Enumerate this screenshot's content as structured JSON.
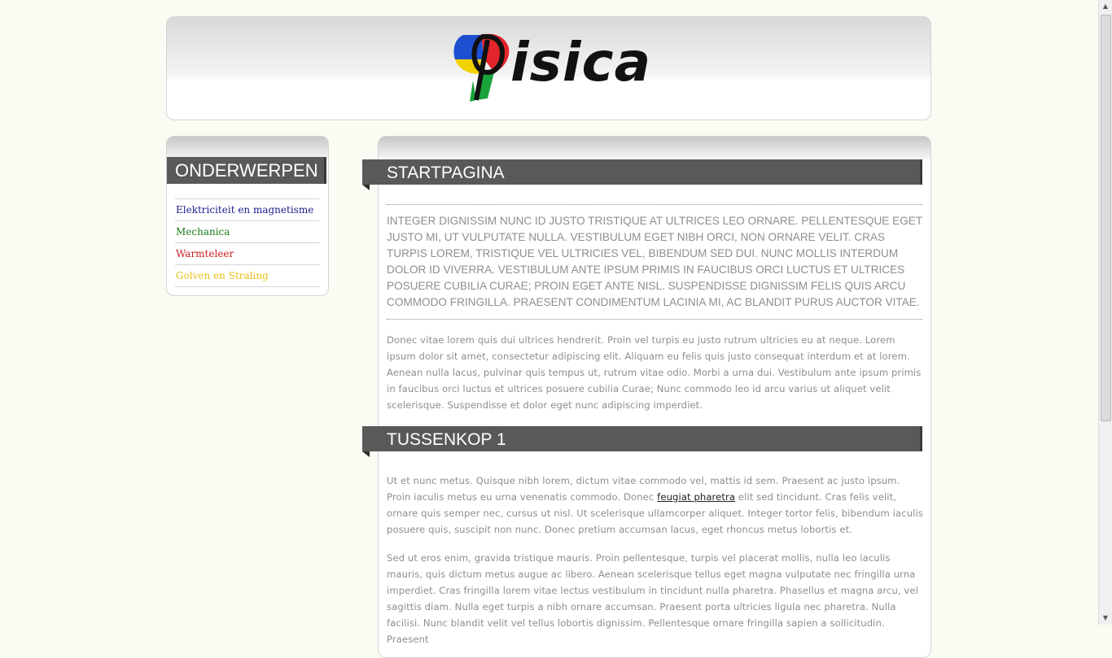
{
  "header": {
    "logo_text": "isica",
    "logo_colors": {
      "red": "#e3262b",
      "blue": "#1d4fd1",
      "yellow": "#f2d200",
      "green": "#19a33a"
    }
  },
  "sidebar": {
    "title": "ONDERWERPEN",
    "items": [
      {
        "label": "Elektriciteit en magnetisme",
        "color": "#1a1a8c"
      },
      {
        "label": "Mechanica",
        "color": "#1c7a1c"
      },
      {
        "label": "Warmteleer",
        "color": "#c8201e"
      },
      {
        "label": "Golven en Straling",
        "color": "#e8c21a"
      }
    ]
  },
  "main": {
    "title": "STARTPAGINA",
    "intro": "Integer dignissim nunc id justo tristique at ultrices leo ornare. Pellentesque eget justo mi, ut vulputate nulla. Vestibulum eget nibh orci, non ornare velit. Cras turpis lorem, tristique vel ultricies vel, bibendum sed dui. Nunc mollis interdum dolor id viverra. Vestibulum ante ipsum primis in faucibus orci luctus et ultrices posuere cubilia Curae; Proin eget ante nisl. Suspendisse dignissim felis quis arcu commodo fringilla. Praesent condimentum lacinia mi, ac blandit purus auctor vitae.",
    "paragraph1": "Donec vitae lorem quis dui ultrices hendrerit. Proin vel turpis eu justo rutrum ultricies eu at neque. Lorem ipsum dolor sit amet, consectetur adipiscing elit. Aliquam eu felis quis justo consequat interdum et at lorem. Aenean nulla lacus, pulvinar quis tempus ut, rutrum vitae odio. Morbi a urna dui. Vestibulum ante ipsum primis in faucibus orci luctus et ultrices posuere cubilia Curae; Nunc commodo leo id arcu varius ut aliquet velit scelerisque. Suspendisse et dolor eget nunc adipiscing imperdiet.",
    "subheading": "TUSSENKOP 1",
    "paragraph2_before": "Ut et nunc metus. Quisque nibh lorem, dictum vitae commodo vel, mattis id sem. Praesent ac justo ipsum. Proin iaculis metus eu urna venenatis commodo. Donec ",
    "paragraph2_link": "feugiat pharetra",
    "paragraph2_after": " elit sed tincidunt. Cras felis velit, ornare quis semper nec, cursus ut nisl. Ut scelerisque ullamcorper aliquet. Integer tortor felis, bibendum iaculis posuere quis, suscipit non nunc. Donec pretium accumsan lacus, eget rhoncus metus lobortis et.",
    "paragraph3": "Sed ut eros enim, gravida tristique mauris. Proin pellentesque, turpis vel placerat mollis, nulla leo iaculis mauris, quis dictum metus augue ac libero. Aenean scelerisque tellus eget magna vulputate nec fringilla urna imperdiet. Cras fringilla lorem vitae lectus vestibulum in tincidunt nulla pharetra. Phasellus et magna arcu, vel sagittis diam. Nulla eget turpis a nibh ornare accumsan. Praesent porta ultricies ligula nec pharetra. Nulla facilisi. Nunc blandit velit vel tellus lobortis dignissim. Pellentesque ornare fringilla sapien a sollicitudin. Praesent"
  }
}
